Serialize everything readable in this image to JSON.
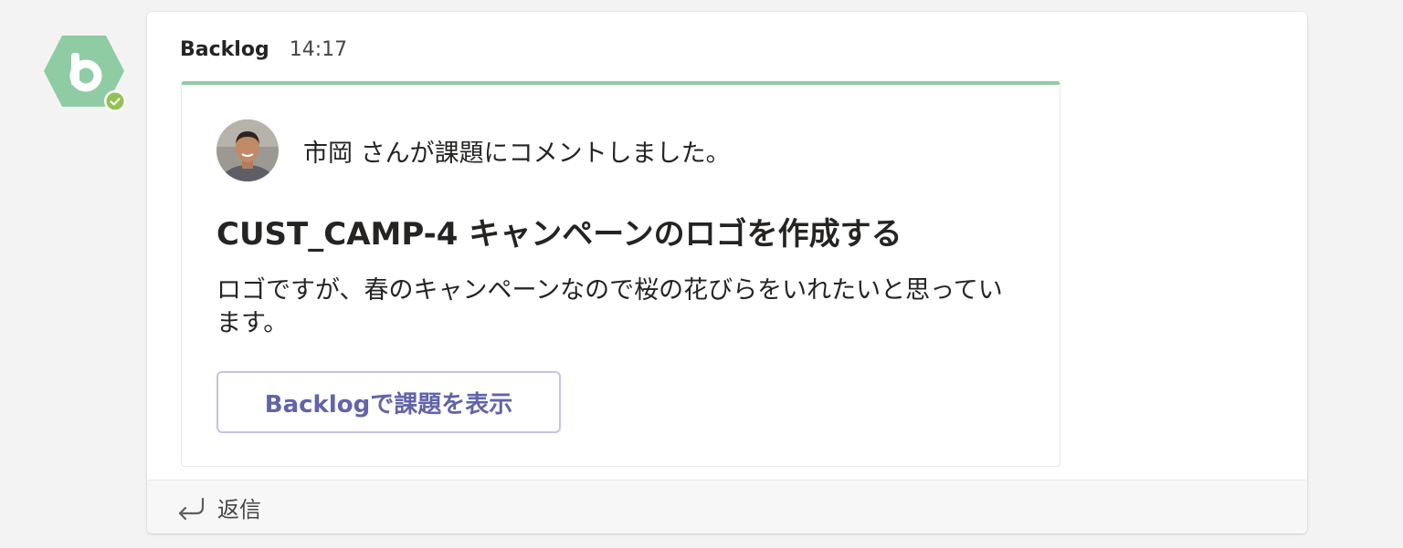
{
  "bot": {
    "icon": "backlog-logo-icon",
    "brand_color": "#8fcca4",
    "status": "available",
    "status_color": "#92c353"
  },
  "message": {
    "sender": "Backlog",
    "time": "14:17"
  },
  "card": {
    "accent_color": "#8fcca4",
    "actor_text": "市岡 さんが課題にコメントしました。",
    "issue_title": "CUST_CAMP-4 キャンペーンのロゴを作成する",
    "comment": "ロゴですが、春のキャンペーンなので桜の花びらをいれたいと思っています。",
    "button_label": "Backlogで課題を表示",
    "button_color": "#6264a7"
  },
  "reply": {
    "label": "返信",
    "icon": "reply-arrow-icon"
  }
}
